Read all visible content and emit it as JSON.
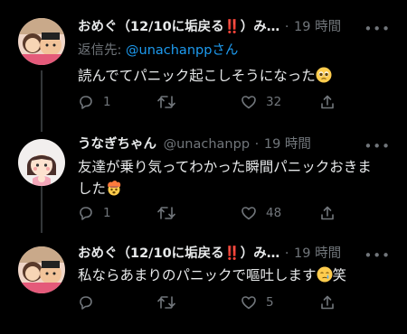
{
  "tweets": [
    {
      "name": "おめぐ（12/10に垢戻る‼️）み…",
      "handle": "",
      "time": "19 時間",
      "reply_prefix": "返信先: ",
      "reply_mention": "@unachanpp",
      "reply_suffix": "さん",
      "text": "読んでてパニック起こしそうになった",
      "emoji": "pleading-face",
      "counts": {
        "reply": "1",
        "retweet": "",
        "like": "32"
      }
    },
    {
      "name": "うなぎちゃん",
      "handle": "@unachanpp",
      "time": "19 時間",
      "text": "友達が乗り気ってわかった瞬間パニックおきました",
      "emoji": "exploding-head",
      "counts": {
        "reply": "1",
        "retweet": "",
        "like": "48"
      }
    },
    {
      "name": "おめぐ（12/10に垢戻る‼️）み…",
      "handle": "",
      "time": "19 時間",
      "text": "私ならあまりのパニックで嘔吐します",
      "emoji": "crying-face",
      "suffix": "笑",
      "counts": {
        "reply": "",
        "retweet": "",
        "like": "5"
      }
    }
  ],
  "ui": {
    "more": "•••",
    "dot": "·"
  },
  "colors": {
    "background": "#000000",
    "text": "#e7e9ea",
    "muted": "#71767b",
    "link": "#1d9bf0",
    "line": "#333639"
  }
}
